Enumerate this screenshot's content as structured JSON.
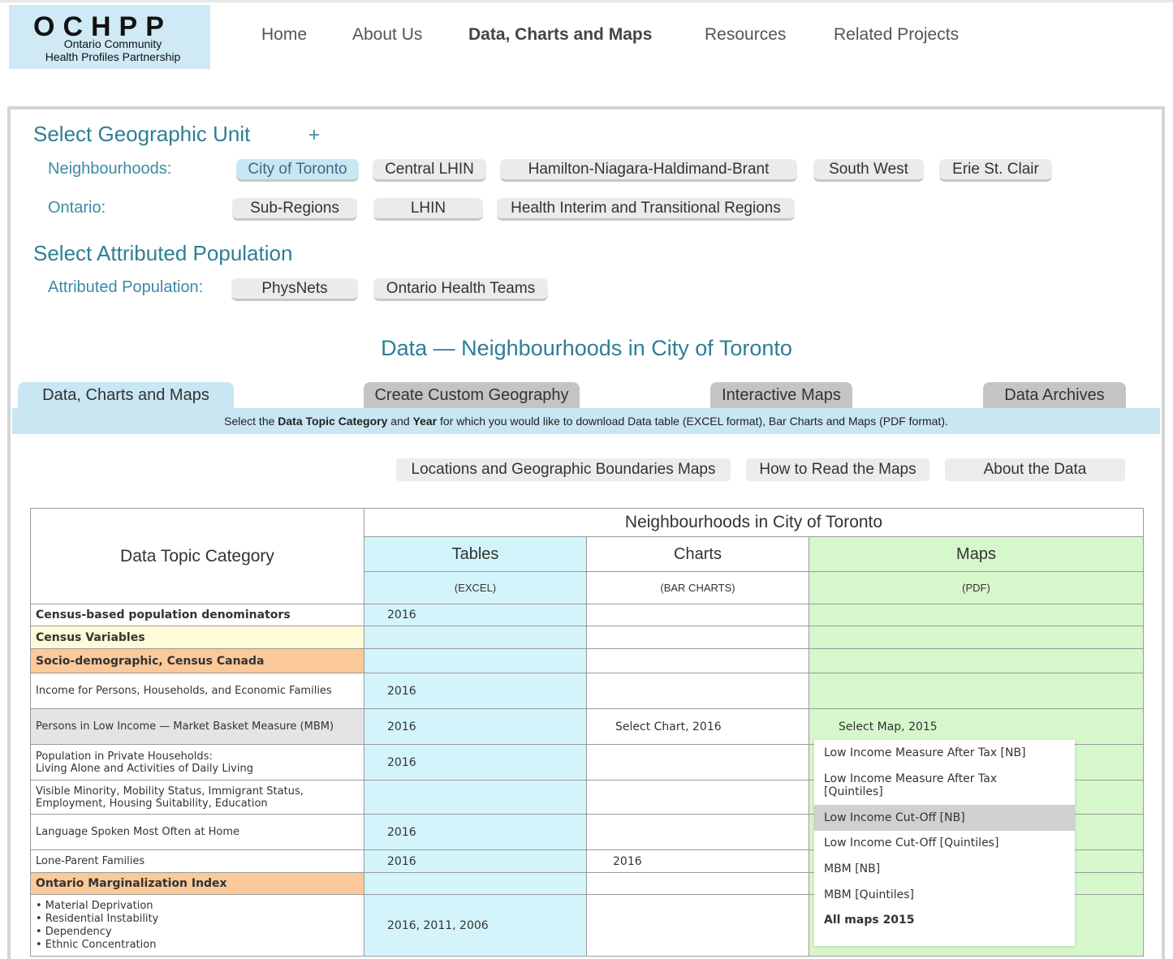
{
  "logo": {
    "big": "OCHPP",
    "line1": "Ontario Community",
    "line2": "Health Profiles Partnership"
  },
  "nav": [
    "Home",
    "About Us",
    "Data, Charts and Maps",
    "Resources",
    "Related Projects"
  ],
  "geo": {
    "title": "Select Geographic Unit",
    "plus": "+",
    "neighbourhoods_label": "Neighbourhoods:",
    "neighbourhoods": [
      "City of Toronto",
      "Central LHIN",
      "Hamilton-Niagara-Haldimand-Brant",
      "South West",
      "Erie St. Clair"
    ],
    "ontario_label": "Ontario:",
    "ontario": [
      "Sub-Regions",
      "LHIN",
      "Health Interim and Transitional Regions"
    ]
  },
  "attr": {
    "title": "Select Attributed Population",
    "label": "Attributed Population:",
    "items": [
      "PhysNets",
      "Ontario Health Teams"
    ]
  },
  "data_title": "Data — Neighbourhoods in City of Toronto",
  "tabs": [
    "Data, Charts and Maps",
    "Create Custom Geography",
    "Interactive Maps",
    "Data Archives"
  ],
  "instruction": {
    "a": "Select the ",
    "b": "Data Topic Category",
    "c": " and ",
    "d": "Year",
    "e": " for which you would like to download Data table (EXCEL format), Bar Charts and Maps (PDF format)."
  },
  "sub_buttons": [
    "Locations and Geographic Boundaries Maps",
    "How to Read the Maps",
    "About the Data"
  ],
  "table": {
    "header_group": "Neighbourhoods in City of Toronto",
    "col_category": "Data Topic Category",
    "col_tables": "Tables",
    "col_tables_note": "(EXCEL)",
    "col_charts": "Charts",
    "col_charts_note": "(BAR CHARTS)",
    "col_maps": "Maps",
    "col_maps_note": "(PDF)",
    "rows": {
      "r1": {
        "cat": "Census-based population denominators",
        "tables": "2016"
      },
      "r2": {
        "cat": "Census Variables"
      },
      "r3": {
        "cat": "Socio-demographic, Census Canada"
      },
      "r4": {
        "cat": "Income for Persons, Households, and Economic Families",
        "tables": "2016"
      },
      "r5": {
        "cat": "Persons in Low Income — Market Basket Measure (MBM)",
        "tables": "2016",
        "charts": "Select Chart, 2016",
        "maps": "Select Map, 2015"
      },
      "r6": {
        "cat_l1": "Population in Private Households:",
        "cat_l2": "Living Alone and Activities of Daily Living",
        "tables": "2016"
      },
      "r7": {
        "cat_l1": "Visible Minority, Mobility Status, Immigrant Status,",
        "cat_l2": "Employment, Housing Suitability, Education"
      },
      "r8": {
        "cat": "Language Spoken Most Often at Home",
        "tables": "2016"
      },
      "r9": {
        "cat": "Lone-Parent Families",
        "tables": "2016",
        "charts": "2016"
      },
      "r10": {
        "cat": "Ontario Marginalization Index"
      },
      "r11": {
        "items": [
          "• Material Deprivation",
          "• Residential Instability",
          "• Dependency",
          "• Ethnic Concentration"
        ],
        "tables": "2016,  2011,  2006"
      }
    }
  },
  "map_menu": [
    "Low Income Measure After Tax [NB]",
    "Low Income Measure After Tax",
    "[Quintiles]",
    "Low Income Cut-Off [NB]",
    "Low Income Cut-Off [Quintiles]",
    "MBM [NB]",
    "MBM [Quintiles]",
    "All maps 2015"
  ]
}
